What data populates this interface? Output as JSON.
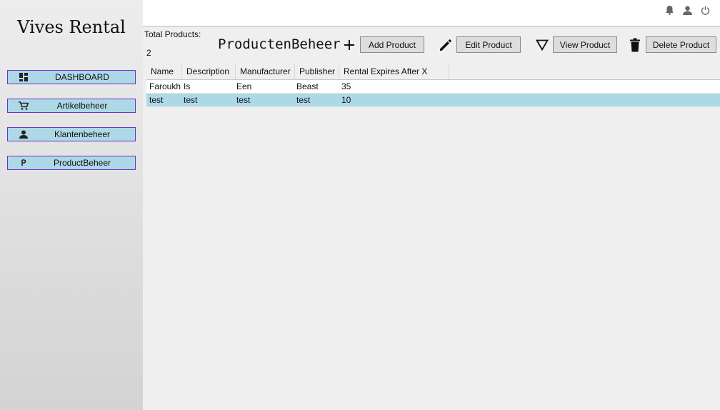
{
  "app": {
    "title": "Vives Rental"
  },
  "sidebar": {
    "items": [
      {
        "label": "DASHBOARD",
        "icon": "dashboard-icon"
      },
      {
        "label": "Artikelbeheer",
        "icon": "cart-icon"
      },
      {
        "label": "Klantenbeheer",
        "icon": "person-icon"
      },
      {
        "label": "ProductBeheer",
        "icon": "p-letter-icon"
      }
    ],
    "colors": {
      "item_bg": "#add8e6",
      "item_border": "#6a32c8"
    }
  },
  "topbar": {
    "icons": [
      "bell-icon",
      "user-icon",
      "power-icon"
    ]
  },
  "summary": {
    "total_label": "Total Products:",
    "total_value": "2"
  },
  "page": {
    "heading": "ProductenBeheer"
  },
  "toolbar": {
    "add_label": "Add Product",
    "edit_label": "Edit Product",
    "view_label": "View Product",
    "delete_label": "Delete Product"
  },
  "table": {
    "columns": [
      "Name",
      "Description",
      "Manufacturer",
      "Publisher",
      "Rental Expires After X Days"
    ],
    "rows": [
      [
        "Faroukh",
        "Is",
        "Een",
        "Beast",
        "35"
      ],
      [
        "test",
        "test",
        "test",
        "test",
        "10"
      ]
    ],
    "selected_row": 1,
    "selected_color": "#add8e6"
  }
}
